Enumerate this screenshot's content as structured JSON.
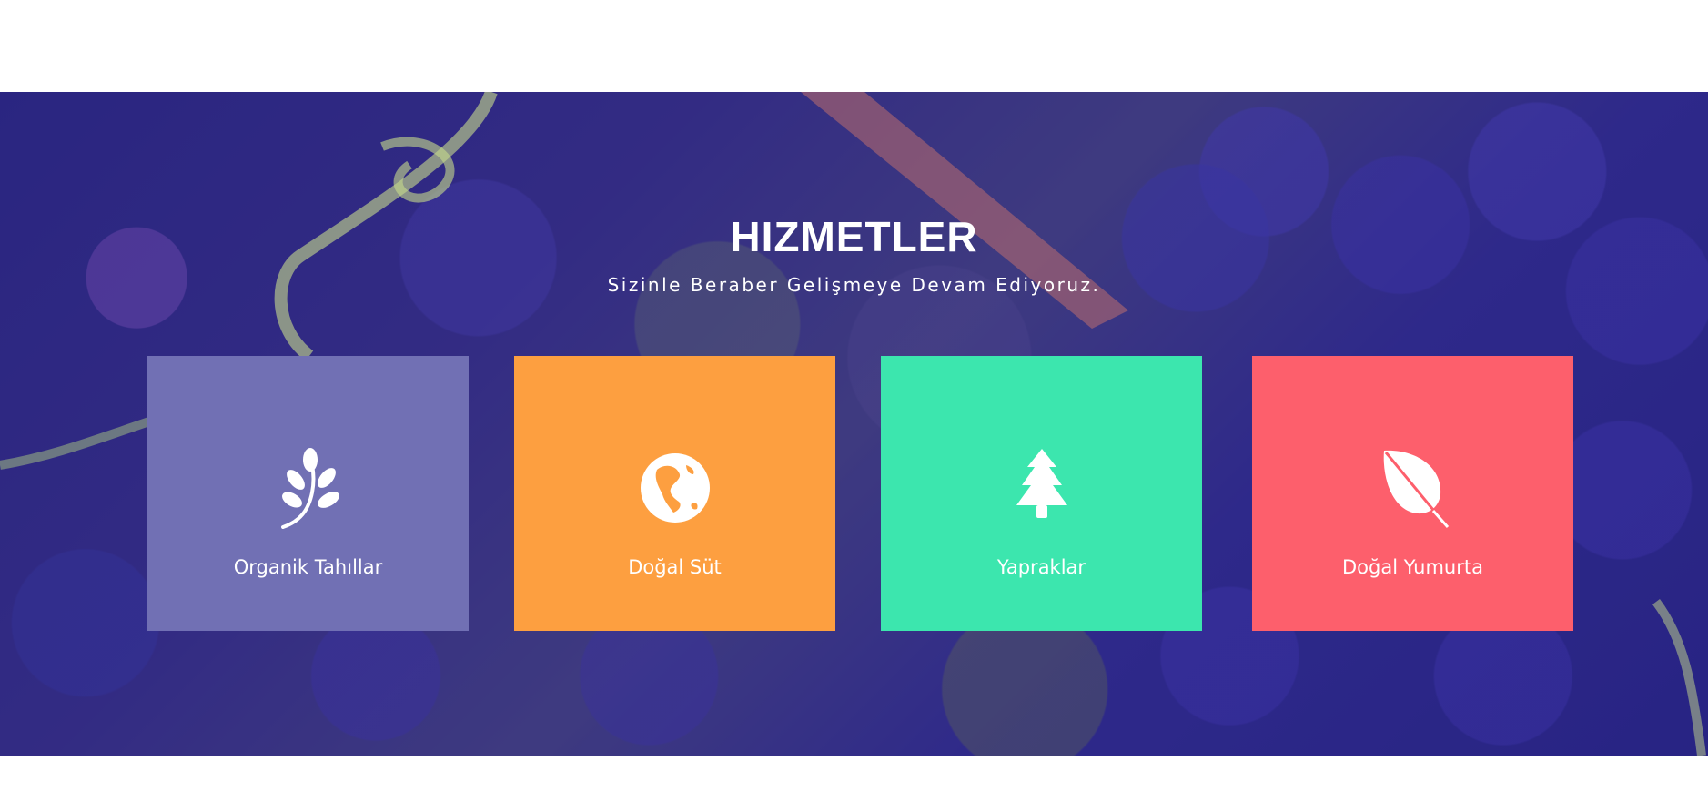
{
  "section": {
    "title": "HIZMETLER",
    "subtitle": "Sizinle Beraber Gelişmeye Devam Ediyoruz."
  },
  "services": [
    {
      "label": "Organik Tahıllar",
      "icon": "wheat-sprig-icon",
      "color": "#7170b4"
    },
    {
      "label": "Doğal Süt",
      "icon": "globe-icon",
      "color": "#fd9f40"
    },
    {
      "label": "Yapraklar",
      "icon": "pine-tree-icon",
      "color": "#3ce6ae"
    },
    {
      "label": "Doğal Yumurta",
      "icon": "leaf-icon",
      "color": "#fd5f6c"
    }
  ],
  "scroll_top": {
    "icon": "triangle-up-icon",
    "color": "#c9822b"
  }
}
